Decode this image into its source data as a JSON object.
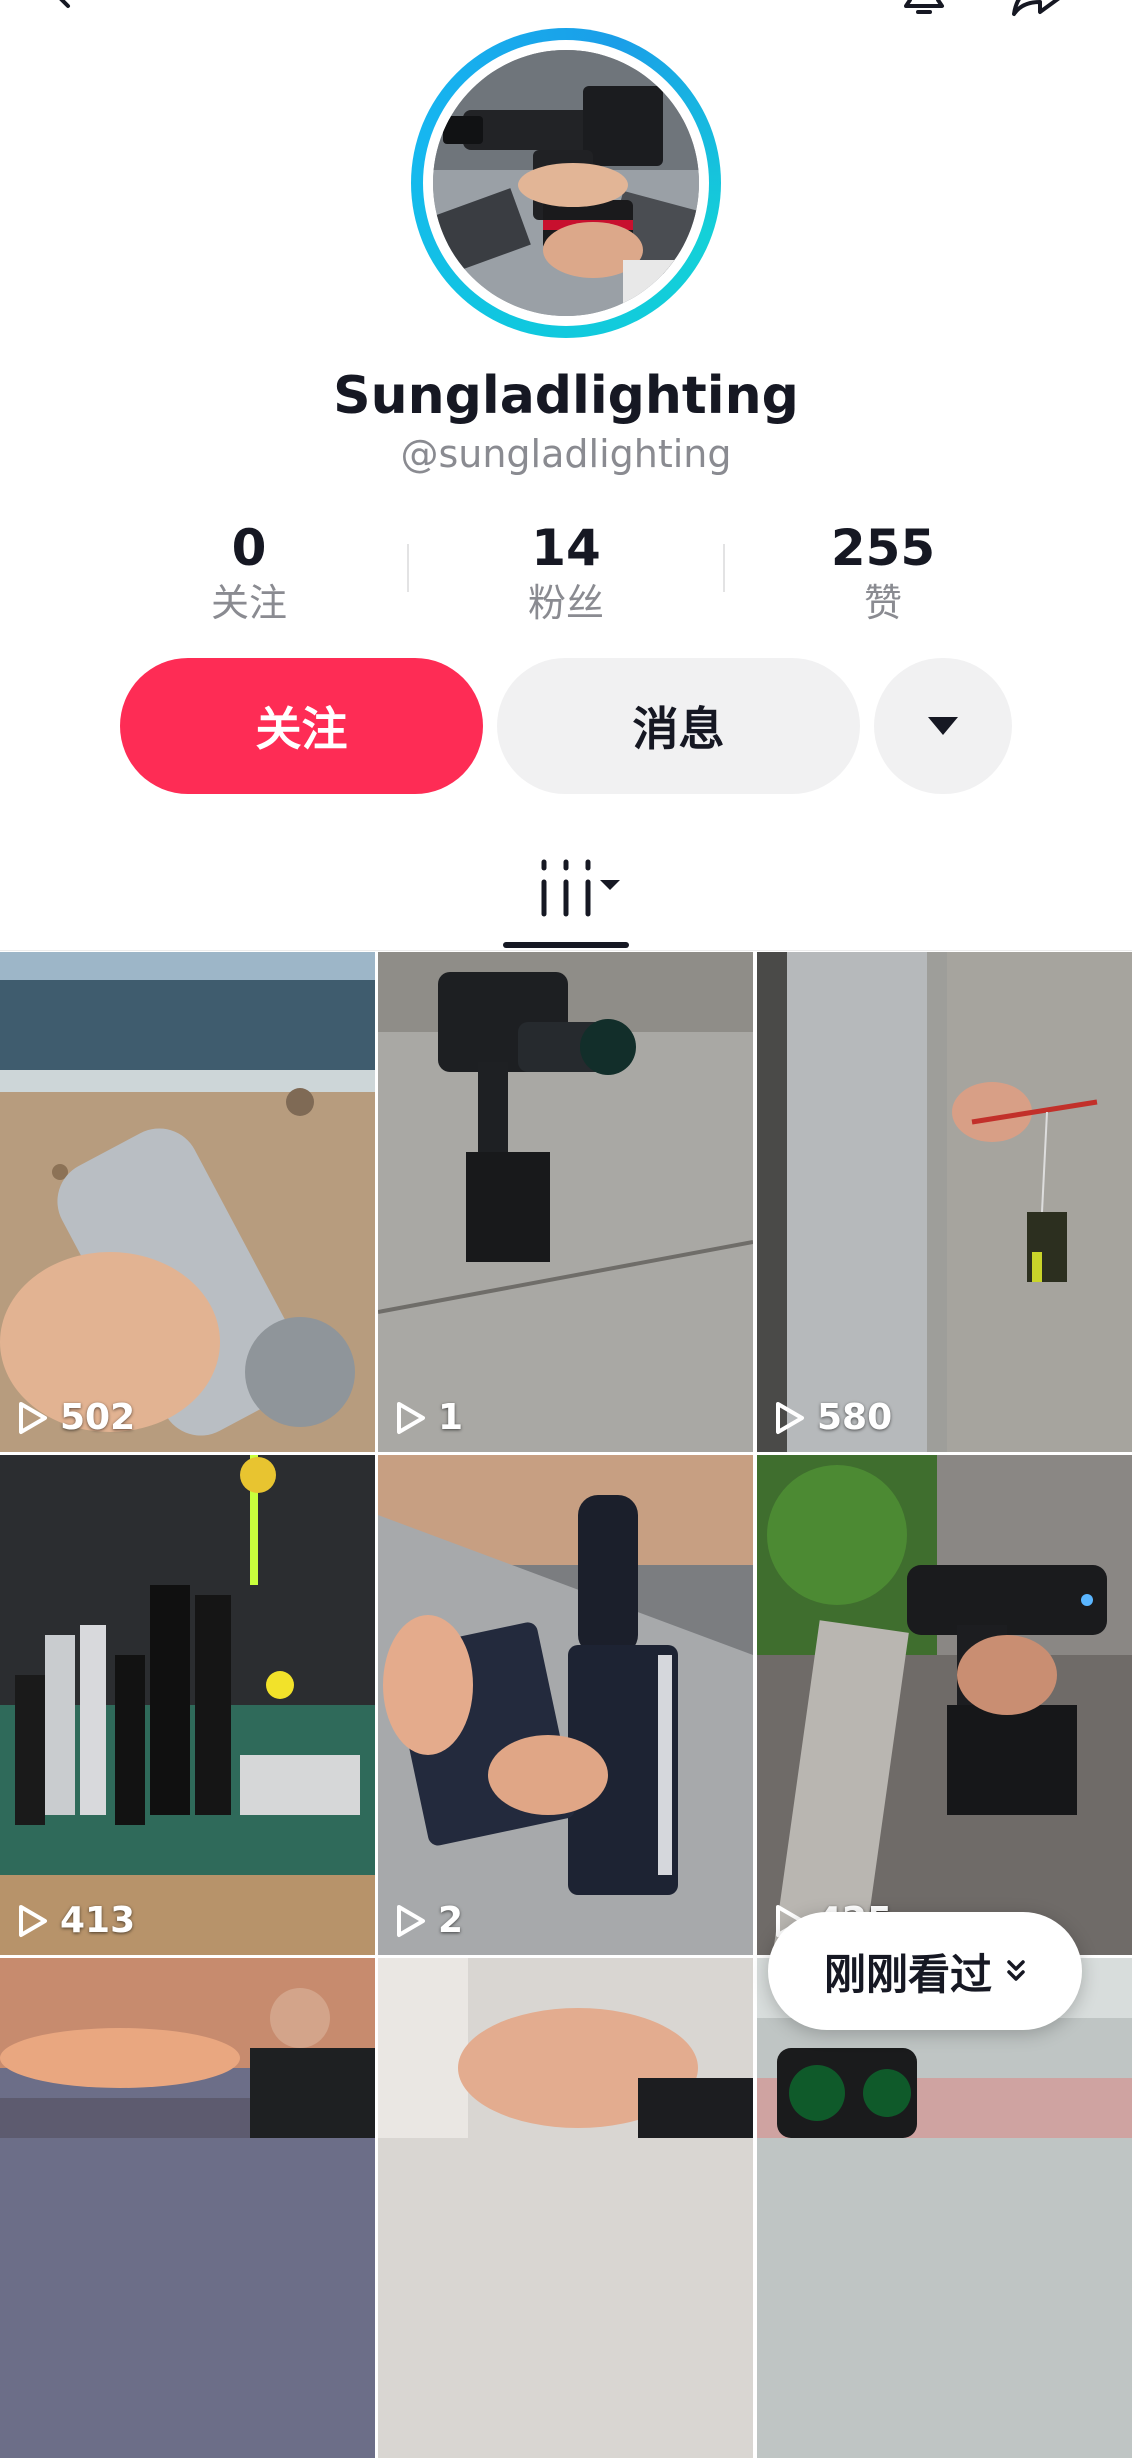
{
  "profile": {
    "display_name": "Sungladlighting",
    "handle": "@sungladlighting"
  },
  "stats": {
    "following": {
      "value": "0",
      "label": "关注"
    },
    "followers": {
      "value": "14",
      "label": "粉丝"
    },
    "likes": {
      "value": "255",
      "label": "赞"
    }
  },
  "actions": {
    "follow_label": "关注",
    "message_label": "消息"
  },
  "colors": {
    "follow_button": "#fe2c55",
    "avatar_ring": "#10c7df",
    "secondary_button": "#f1f1f2"
  },
  "videos": [
    {
      "views": "502"
    },
    {
      "views": "1"
    },
    {
      "views": "580"
    },
    {
      "views": "413"
    },
    {
      "views": "2"
    },
    {
      "views": "425"
    },
    {
      "views": ""
    },
    {
      "views": ""
    },
    {
      "views": ""
    }
  ],
  "floating": {
    "recently_viewed_label": "刚刚看过"
  }
}
